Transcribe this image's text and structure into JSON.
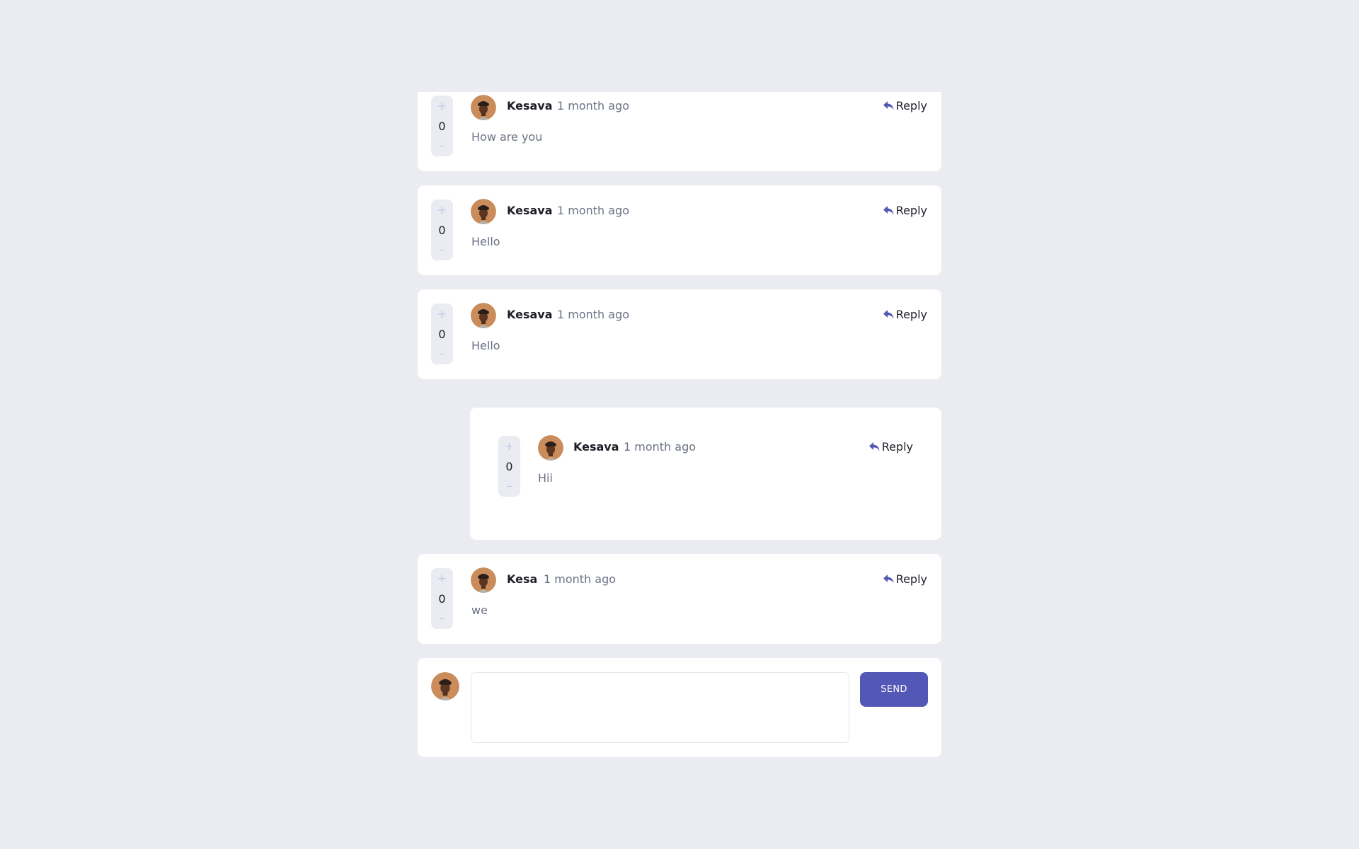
{
  "comments": [
    {
      "score": "0",
      "username": "Kesava",
      "time": "1 month ago",
      "reply_label": "Reply",
      "text": "How are you"
    },
    {
      "score": "0",
      "username": "Kesava",
      "time": "1 month ago",
      "reply_label": "Reply",
      "text": "Hello"
    },
    {
      "score": "0",
      "username": "Kesava",
      "time": "1 month ago",
      "reply_label": "Reply",
      "text": "Hello"
    },
    {
      "score": "0",
      "username": "Kesava",
      "time": "1 month ago",
      "reply_label": "Reply",
      "text": "Hii"
    },
    {
      "score": "0",
      "username": "Kesa",
      "time": "1 month ago",
      "reply_label": "Reply",
      "text": "we"
    }
  ],
  "vote": {
    "plus": "+",
    "minus": "–"
  },
  "composer": {
    "value": "",
    "send_label": "SEND"
  },
  "icons": {
    "reply": "reply-arrow-icon",
    "avatar": "user-avatar"
  },
  "colors": {
    "accent": "#5357b6",
    "vote_glyph": "#c4c6e8",
    "background": "#eaecf1",
    "card": "#ffffff"
  }
}
